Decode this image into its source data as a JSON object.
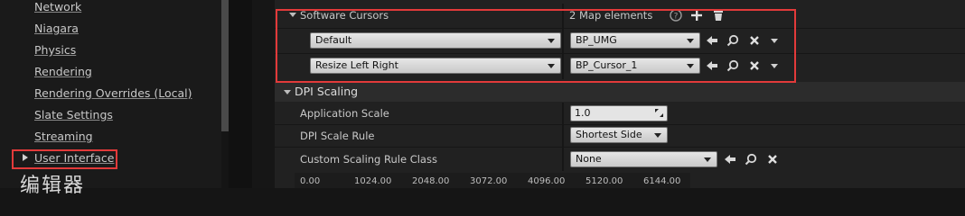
{
  "sidebar": {
    "items": [
      {
        "label": "Network"
      },
      {
        "label": "Niagara"
      },
      {
        "label": "Physics"
      },
      {
        "label": "Rendering"
      },
      {
        "label": "Rendering Overrides (Local)"
      },
      {
        "label": "Slate Settings"
      },
      {
        "label": "Streaming"
      },
      {
        "label": "User Interface"
      }
    ],
    "section_heading": "编辑器"
  },
  "software_cursors": {
    "label": "Software Cursors",
    "count_text": "2 Map elements",
    "entries": [
      {
        "key": "Default",
        "value": "BP_UMG"
      },
      {
        "key": "Resize Left Right",
        "value": "BP_Cursor_1"
      }
    ]
  },
  "dpi_scaling": {
    "title": "DPI Scaling",
    "application_scale": {
      "label": "Application Scale",
      "value": "1.0"
    },
    "dpi_scale_rule": {
      "label": "DPI Scale Rule",
      "value": "Shortest Side"
    },
    "custom_scaling_rule_class": {
      "label": "Custom Scaling Rule Class",
      "value": "None"
    }
  },
  "ruler": {
    "ticks": [
      "0.00",
      "1024.00",
      "2048.00",
      "3072.00",
      "4096.00",
      "5120.00",
      "6144.00"
    ]
  },
  "colors": {
    "highlight": "#e23a3a",
    "panel": "#212121",
    "sidebar": "#1a1a1a"
  }
}
